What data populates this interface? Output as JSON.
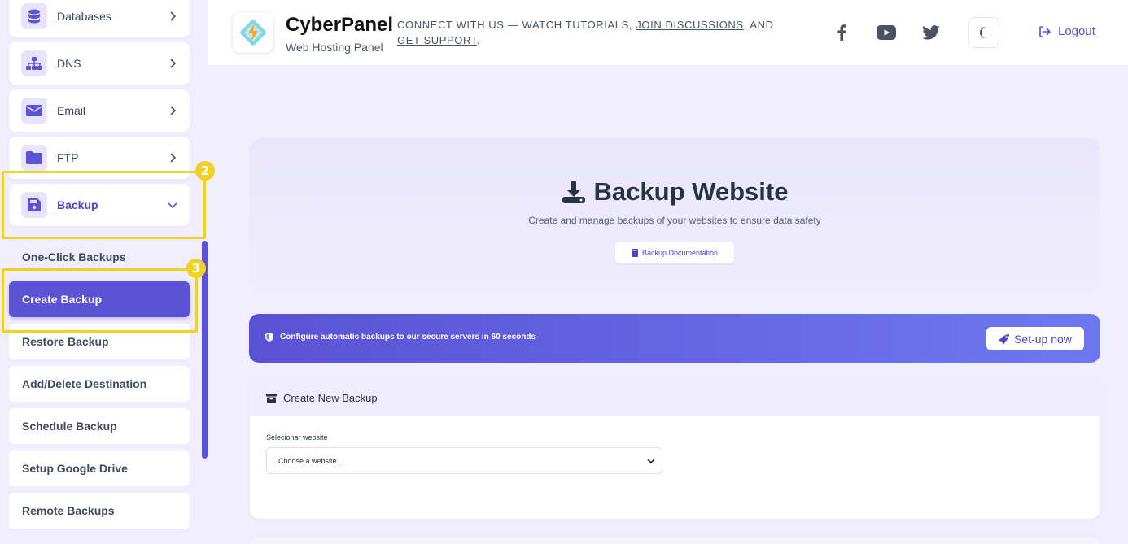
{
  "sidebar": {
    "nav": [
      {
        "label": "Databases",
        "icon": "database-icon"
      },
      {
        "label": "DNS",
        "icon": "sitemap-icon"
      },
      {
        "label": "Email",
        "icon": "envelope-icon"
      },
      {
        "label": "FTP",
        "icon": "folder-icon"
      },
      {
        "label": "Backup",
        "icon": "floppy-disk-icon"
      }
    ],
    "subitems": [
      {
        "label": "One-Click Backups"
      },
      {
        "label": "Create Backup"
      },
      {
        "label": "Restore Backup"
      },
      {
        "label": "Add/Delete Destination"
      },
      {
        "label": "Schedule Backup"
      },
      {
        "label": "Setup Google Drive"
      },
      {
        "label": "Remote Backups"
      }
    ],
    "markers": [
      "2",
      "3"
    ]
  },
  "header": {
    "brand_title": "CyberPanel",
    "brand_subtitle": "Web Hosting Panel",
    "connect_text": "Connect with us — watch tutorials, ",
    "connect_link1": "join discussions",
    "connect_mid": ", and ",
    "connect_link2": "get support",
    "connect_end": ".",
    "social_icons": [
      "facebook-icon",
      "youtube-icon",
      "twitter-icon"
    ],
    "logout_label": "Logout"
  },
  "hero": {
    "title": "Backup Website",
    "subtitle": "Create and manage backups of your websites to ensure data safety",
    "doc_button": "Backup Documentation"
  },
  "promo": {
    "text": "Configure automatic backups to our secure servers in 60 seconds",
    "button": "Set-up now"
  },
  "panel": {
    "title": "Create New Backup",
    "field_label": "Selecionar website",
    "select_value": "Choose a website..."
  },
  "colors": {
    "accent": "#5b52d6",
    "highlight": "#f2d024",
    "background": "#f0eefc"
  }
}
